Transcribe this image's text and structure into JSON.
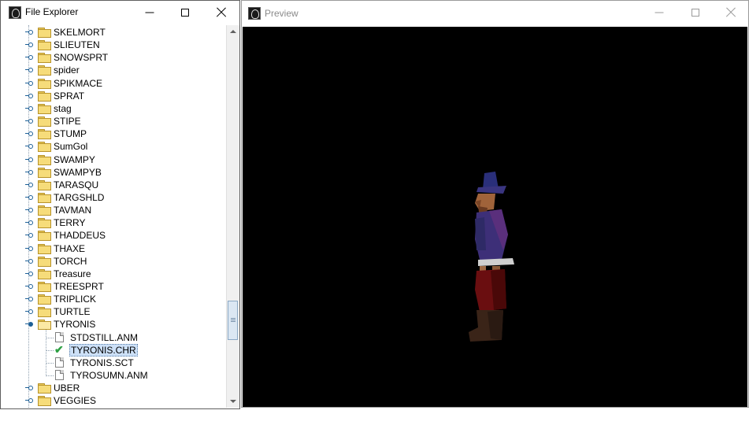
{
  "file_explorer": {
    "title": "File Explorer",
    "items": [
      {
        "type": "folder",
        "label": "SKELMORT",
        "open": false
      },
      {
        "type": "folder",
        "label": "SLIEUTEN",
        "open": false
      },
      {
        "type": "folder",
        "label": "SNOWSPRT",
        "open": false
      },
      {
        "type": "folder",
        "label": "spider",
        "open": false
      },
      {
        "type": "folder",
        "label": "SPIKMACE",
        "open": false
      },
      {
        "type": "folder",
        "label": "SPRAT",
        "open": false
      },
      {
        "type": "folder",
        "label": "stag",
        "open": false
      },
      {
        "type": "folder",
        "label": "STIPE",
        "open": false
      },
      {
        "type": "folder",
        "label": "STUMP",
        "open": false
      },
      {
        "type": "folder",
        "label": "SumGol",
        "open": false
      },
      {
        "type": "folder",
        "label": "SWAMPY",
        "open": false
      },
      {
        "type": "folder",
        "label": "SWAMPYB",
        "open": false
      },
      {
        "type": "folder",
        "label": "TARASQU",
        "open": false
      },
      {
        "type": "folder",
        "label": "TARGSHLD",
        "open": false
      },
      {
        "type": "folder",
        "label": "TAVMAN",
        "open": false
      },
      {
        "type": "folder",
        "label": "TERRY",
        "open": false
      },
      {
        "type": "folder",
        "label": "THADDEUS",
        "open": false
      },
      {
        "type": "folder",
        "label": "THAXE",
        "open": false
      },
      {
        "type": "folder",
        "label": "TORCH",
        "open": false
      },
      {
        "type": "folder",
        "label": "Treasure",
        "open": false
      },
      {
        "type": "folder",
        "label": "TREESPRT",
        "open": false
      },
      {
        "type": "folder",
        "label": "TRIPLICK",
        "open": false
      },
      {
        "type": "folder",
        "label": "TURTLE",
        "open": false
      },
      {
        "type": "folder",
        "label": "TYRONIS",
        "open": true
      },
      {
        "type": "file",
        "label": "STDSTILL.ANM",
        "checked": false,
        "selected": false
      },
      {
        "type": "file",
        "label": "TYRONIS.CHR",
        "checked": true,
        "selected": true
      },
      {
        "type": "file",
        "label": "TYRONIS.SCT",
        "checked": false,
        "selected": false
      },
      {
        "type": "file",
        "label": "TYROSUMN.ANM",
        "checked": false,
        "selected": false
      },
      {
        "type": "folder",
        "label": "UBER",
        "open": false
      },
      {
        "type": "folder",
        "label": "VEGGIES",
        "open": false
      }
    ]
  },
  "preview": {
    "title": "Preview"
  },
  "icons": {
    "app": "app-logo-icon",
    "minimize": "minimize-icon",
    "maximize": "maximize-icon",
    "close": "close-icon",
    "folder": "folder-icon",
    "file": "file-icon",
    "check": "checkmark-icon"
  },
  "colors": {
    "selection": "#cce0f7",
    "check": "#2ea043",
    "viewport": "#000000"
  }
}
